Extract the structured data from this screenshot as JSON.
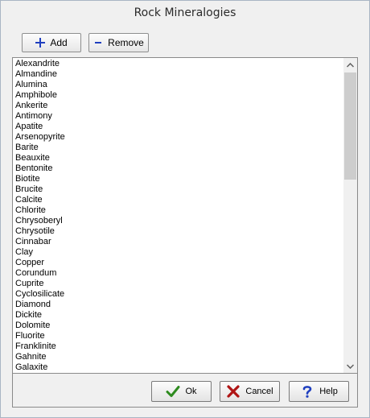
{
  "window": {
    "title": "Rock Mineralogies"
  },
  "toolbar": {
    "add_label": "Add",
    "remove_label": "Remove"
  },
  "minerals": [
    "Alexandrite",
    "Almandine",
    "Alumina",
    "Amphibole",
    "Ankerite",
    "Antimony",
    "Apatite",
    "Arsenopyrite",
    "Barite",
    "Beauxite",
    "Bentonite",
    "Biotite",
    "Brucite",
    "Calcite",
    "Chlorite",
    "Chrysoberyl",
    "Chrysotile",
    "Cinnabar",
    "Clay",
    "Copper",
    "Corundum",
    "Cuprite",
    "Cyclosilicate",
    "Diamond",
    "Dickite",
    "Dolomite",
    "Fluorite",
    "Franklinite",
    "Gahnite",
    "Galaxite"
  ],
  "buttons": {
    "ok_label": "Ok",
    "cancel_label": "Cancel",
    "help_label": "Help"
  },
  "icons": {
    "add": "plus-icon",
    "remove": "minus-icon",
    "ok": "checkmark-icon",
    "cancel": "x-icon",
    "help": "question-icon"
  },
  "colors": {
    "accent_blue": "#1f3fbf",
    "ok_green": "#2e8b1f",
    "cancel_red": "#b01515"
  }
}
